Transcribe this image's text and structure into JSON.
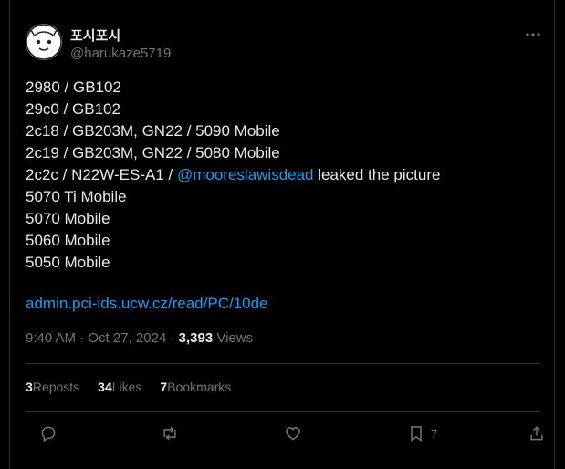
{
  "author": {
    "display_name": "포시포시",
    "handle": "@harukaze5719"
  },
  "header": {
    "more_icon": "more-horizontal-icon"
  },
  "tweet": {
    "lines": [
      "2980 / GB102",
      "29c0 / GB102",
      "2c18 / GB203M, GN22 / 5090 Mobile",
      "2c19 / GB203M, GN22 / 5080 Mobile",
      "2c2c / N22W-ES-A1 / ",
      "5070 Ti Mobile",
      "5070 Mobile",
      "5060 Mobile",
      "5050 Mobile"
    ],
    "mention": "@mooreslawisdead",
    "mention_suffix": " leaked the picture",
    "link_text": "admin.pci-ids.ucw.cz/read/PC/10de"
  },
  "meta": {
    "time": "9:40 AM",
    "separator": " · ",
    "date": "Oct 27, 2024",
    "views_count": "3,393",
    "views_label": " Views"
  },
  "stats": {
    "reposts_count": "3",
    "reposts_label": "Reposts",
    "likes_count": "34",
    "likes_label": "Likes",
    "bookmarks_count": "7",
    "bookmarks_label": "Bookmarks"
  },
  "actions": {
    "reply_icon": "reply-icon",
    "repost_icon": "repost-icon",
    "like_icon": "like-icon",
    "bookmark_icon": "bookmark-icon",
    "bookmark_count": "7",
    "share_icon": "share-icon"
  },
  "colors": {
    "background": "#000000",
    "text": "#e7e9ea",
    "muted": "#71767b",
    "accent": "#1d9bf0",
    "border": "#2f3336"
  }
}
